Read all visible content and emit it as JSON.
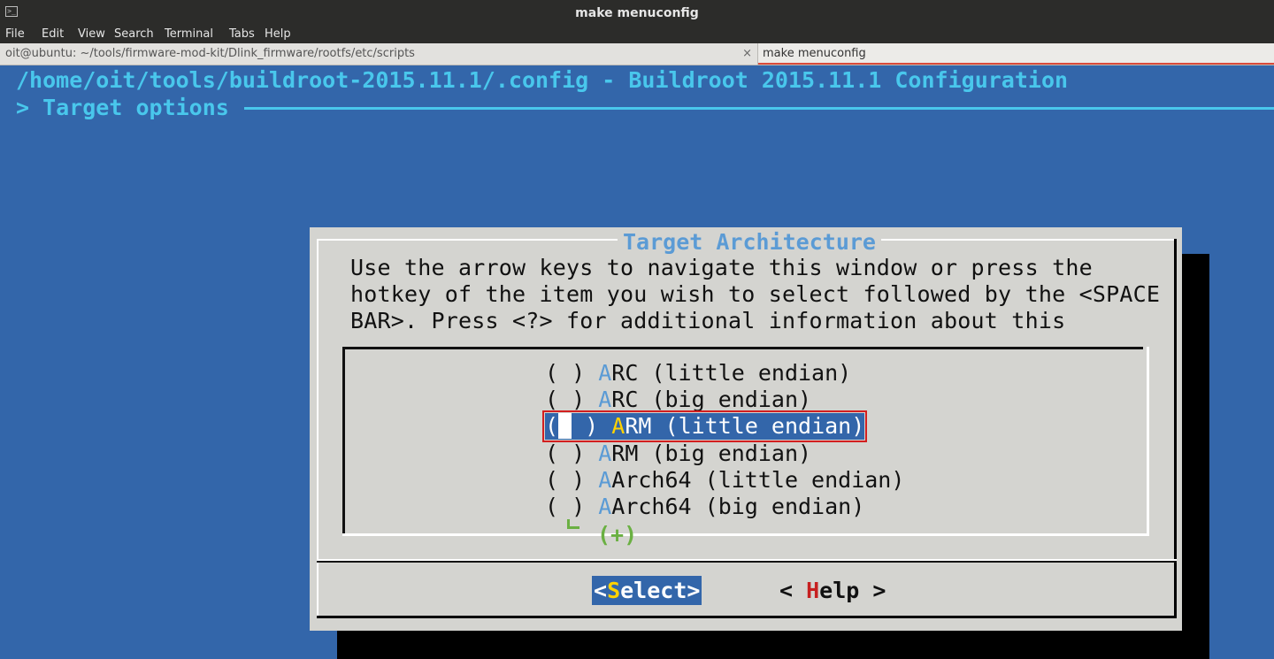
{
  "window": {
    "title": "make menuconfig"
  },
  "menubar": [
    "File",
    "Edit",
    "View",
    "Search",
    "Terminal",
    "Tabs",
    "Help"
  ],
  "tabs": [
    {
      "label": "oit@ubuntu: ~/tools/firmware-mod-kit/Dlink_firmware/rootfs/etc/scripts",
      "close": "×"
    },
    {
      "label": "make menuconfig"
    }
  ],
  "header": {
    "path": "/home/oit/tools/buildroot-2015.11.1/.config - Buildroot 2015.11.1 Configuration",
    "breadcrumb": "> Target options"
  },
  "dialog": {
    "title": "Target Architecture",
    "help_lines": [
      "Use the arrow keys to navigate this window or press the",
      "hotkey of the item you wish to select followed by the <SPACE",
      "BAR>. Press <?> for additional information about this"
    ],
    "items": [
      {
        "mark": "( )",
        "hotkey": "A",
        "rest": "RC (little endian)"
      },
      {
        "mark": "( )",
        "hotkey": "A",
        "rest": "RC (big endian)"
      },
      {
        "mark_open": "(",
        "mark_close": " )",
        "hotkey": "A",
        "rest": "RM (little endian)"
      },
      {
        "mark": "( )",
        "hotkey": "A",
        "rest": "RM (big endian)"
      },
      {
        "mark": "( )",
        "hotkey": "A",
        "rest": "Arch64 (little endian)"
      },
      {
        "mark": "( )",
        "hotkey": "A",
        "rest": "Arch64 (big endian)"
      }
    ],
    "more_indicator": "(+)",
    "buttons": {
      "select": {
        "prefix": "<",
        "hotkey": "S",
        "rest": "elect>"
      },
      "help": {
        "prefix": "< ",
        "hotkey": "H",
        "rest": "elp >"
      }
    }
  },
  "colors": {
    "terminal_bg": "#3366aa",
    "header_text": "#49c7ec",
    "dialog_bg": "#d4d4d0",
    "hotkey": "#5b9bd5",
    "selected_hotkey": "#ffd200",
    "help_hotkey": "#c62020",
    "more_indicator": "#6ab042",
    "highlight_outline": "#d21f1f"
  }
}
